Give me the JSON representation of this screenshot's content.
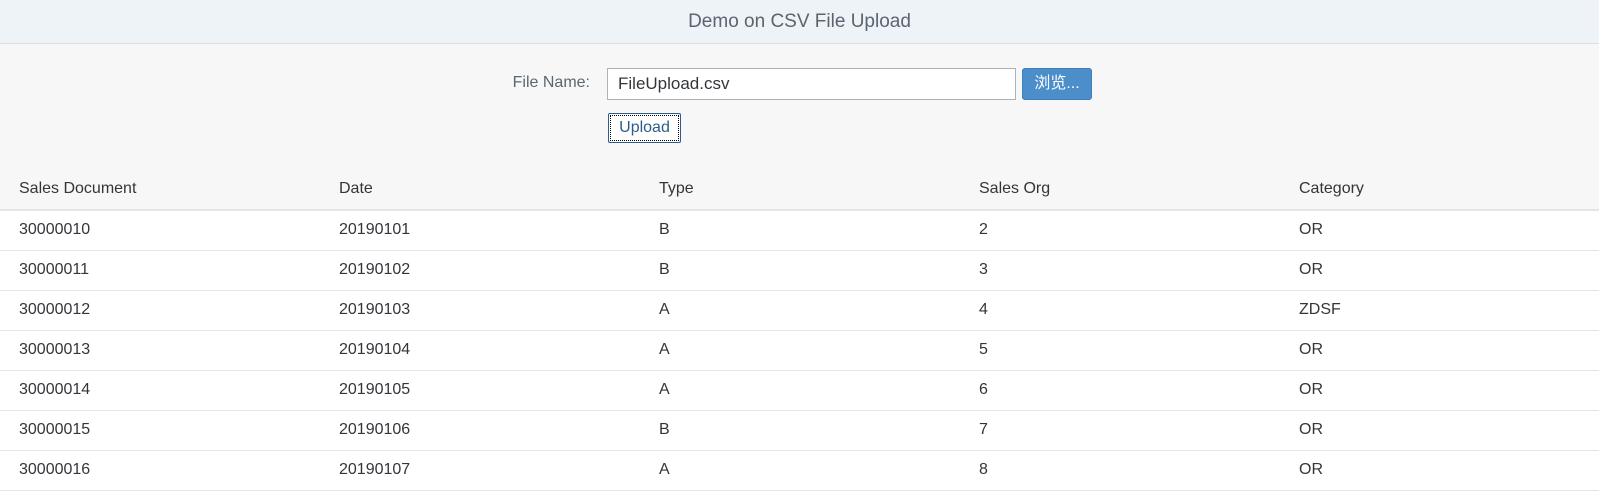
{
  "header": {
    "title": "Demo on CSV File Upload"
  },
  "form": {
    "file_label": "File Name:",
    "file_value": "FileUpload.csv",
    "browse_label": "浏览...",
    "upload_label": "Upload"
  },
  "table": {
    "columns": [
      "Sales Document",
      "Date",
      "Type",
      "Sales Org",
      "Category"
    ],
    "rows": [
      [
        "30000010",
        "20190101",
        "B",
        "2",
        "OR"
      ],
      [
        "30000011",
        "20190102",
        "B",
        "3",
        "OR"
      ],
      [
        "30000012",
        "20190103",
        "A",
        "4",
        "ZDSF"
      ],
      [
        "30000013",
        "20190104",
        "A",
        "5",
        "OR"
      ],
      [
        "30000014",
        "20190105",
        "A",
        "6",
        "OR"
      ],
      [
        "30000015",
        "20190106",
        "B",
        "7",
        "OR"
      ],
      [
        "30000016",
        "20190107",
        "A",
        "8",
        "OR"
      ]
    ]
  }
}
